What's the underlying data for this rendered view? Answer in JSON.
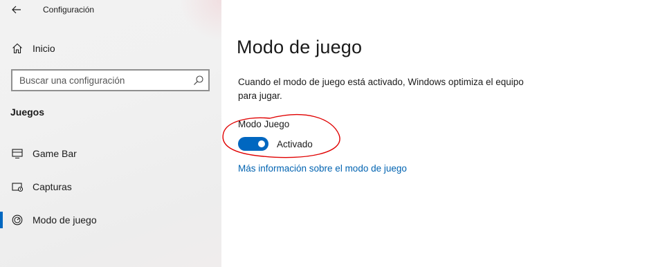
{
  "window": {
    "title": "Configuración"
  },
  "sidebar": {
    "home_label": "Inicio",
    "search_placeholder": "Buscar una configuración",
    "section_title": "Juegos",
    "items": [
      {
        "label": "Game Bar",
        "icon": "game-bar-icon",
        "selected": false
      },
      {
        "label": "Capturas",
        "icon": "capture-icon",
        "selected": false
      },
      {
        "label": "Modo de juego",
        "icon": "game-mode-icon",
        "selected": true
      }
    ]
  },
  "main": {
    "page_title": "Modo de juego",
    "description": "Cuando el modo de juego está activado, Windows optimiza el equipo para jugar.",
    "toggle": {
      "label": "Modo Juego",
      "state_text": "Activado",
      "on": true
    },
    "link": "Más información sobre el modo de juego"
  },
  "colors": {
    "accent": "#0067c0",
    "link": "#0063b1",
    "annotation": "#e00000"
  }
}
